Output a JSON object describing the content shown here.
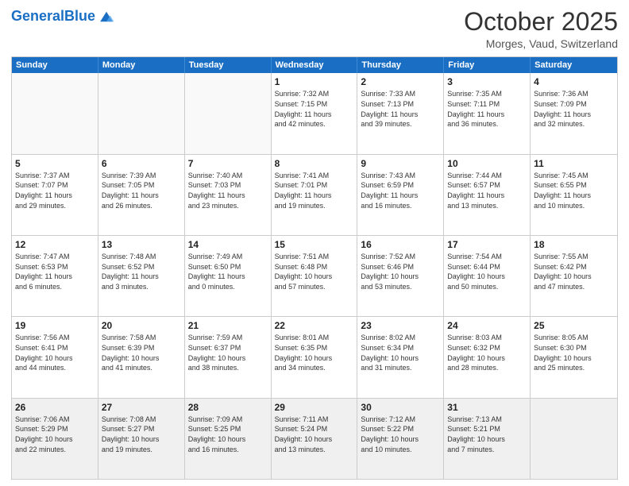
{
  "header": {
    "logo_general": "General",
    "logo_blue": "Blue",
    "month_title": "October 2025",
    "location": "Morges, Vaud, Switzerland"
  },
  "weekdays": [
    "Sunday",
    "Monday",
    "Tuesday",
    "Wednesday",
    "Thursday",
    "Friday",
    "Saturday"
  ],
  "rows": [
    [
      {
        "day": "",
        "text": "",
        "empty": true
      },
      {
        "day": "",
        "text": "",
        "empty": true
      },
      {
        "day": "",
        "text": "",
        "empty": true
      },
      {
        "day": "1",
        "text": "Sunrise: 7:32 AM\nSunset: 7:15 PM\nDaylight: 11 hours\nand 42 minutes."
      },
      {
        "day": "2",
        "text": "Sunrise: 7:33 AM\nSunset: 7:13 PM\nDaylight: 11 hours\nand 39 minutes."
      },
      {
        "day": "3",
        "text": "Sunrise: 7:35 AM\nSunset: 7:11 PM\nDaylight: 11 hours\nand 36 minutes."
      },
      {
        "day": "4",
        "text": "Sunrise: 7:36 AM\nSunset: 7:09 PM\nDaylight: 11 hours\nand 32 minutes."
      }
    ],
    [
      {
        "day": "5",
        "text": "Sunrise: 7:37 AM\nSunset: 7:07 PM\nDaylight: 11 hours\nand 29 minutes."
      },
      {
        "day": "6",
        "text": "Sunrise: 7:39 AM\nSunset: 7:05 PM\nDaylight: 11 hours\nand 26 minutes."
      },
      {
        "day": "7",
        "text": "Sunrise: 7:40 AM\nSunset: 7:03 PM\nDaylight: 11 hours\nand 23 minutes."
      },
      {
        "day": "8",
        "text": "Sunrise: 7:41 AM\nSunset: 7:01 PM\nDaylight: 11 hours\nand 19 minutes."
      },
      {
        "day": "9",
        "text": "Sunrise: 7:43 AM\nSunset: 6:59 PM\nDaylight: 11 hours\nand 16 minutes."
      },
      {
        "day": "10",
        "text": "Sunrise: 7:44 AM\nSunset: 6:57 PM\nDaylight: 11 hours\nand 13 minutes."
      },
      {
        "day": "11",
        "text": "Sunrise: 7:45 AM\nSunset: 6:55 PM\nDaylight: 11 hours\nand 10 minutes."
      }
    ],
    [
      {
        "day": "12",
        "text": "Sunrise: 7:47 AM\nSunset: 6:53 PM\nDaylight: 11 hours\nand 6 minutes."
      },
      {
        "day": "13",
        "text": "Sunrise: 7:48 AM\nSunset: 6:52 PM\nDaylight: 11 hours\nand 3 minutes."
      },
      {
        "day": "14",
        "text": "Sunrise: 7:49 AM\nSunset: 6:50 PM\nDaylight: 11 hours\nand 0 minutes."
      },
      {
        "day": "15",
        "text": "Sunrise: 7:51 AM\nSunset: 6:48 PM\nDaylight: 10 hours\nand 57 minutes."
      },
      {
        "day": "16",
        "text": "Sunrise: 7:52 AM\nSunset: 6:46 PM\nDaylight: 10 hours\nand 53 minutes."
      },
      {
        "day": "17",
        "text": "Sunrise: 7:54 AM\nSunset: 6:44 PM\nDaylight: 10 hours\nand 50 minutes."
      },
      {
        "day": "18",
        "text": "Sunrise: 7:55 AM\nSunset: 6:42 PM\nDaylight: 10 hours\nand 47 minutes."
      }
    ],
    [
      {
        "day": "19",
        "text": "Sunrise: 7:56 AM\nSunset: 6:41 PM\nDaylight: 10 hours\nand 44 minutes."
      },
      {
        "day": "20",
        "text": "Sunrise: 7:58 AM\nSunset: 6:39 PM\nDaylight: 10 hours\nand 41 minutes."
      },
      {
        "day": "21",
        "text": "Sunrise: 7:59 AM\nSunset: 6:37 PM\nDaylight: 10 hours\nand 38 minutes."
      },
      {
        "day": "22",
        "text": "Sunrise: 8:01 AM\nSunset: 6:35 PM\nDaylight: 10 hours\nand 34 minutes."
      },
      {
        "day": "23",
        "text": "Sunrise: 8:02 AM\nSunset: 6:34 PM\nDaylight: 10 hours\nand 31 minutes."
      },
      {
        "day": "24",
        "text": "Sunrise: 8:03 AM\nSunset: 6:32 PM\nDaylight: 10 hours\nand 28 minutes."
      },
      {
        "day": "25",
        "text": "Sunrise: 8:05 AM\nSunset: 6:30 PM\nDaylight: 10 hours\nand 25 minutes."
      }
    ],
    [
      {
        "day": "26",
        "text": "Sunrise: 7:06 AM\nSunset: 5:29 PM\nDaylight: 10 hours\nand 22 minutes."
      },
      {
        "day": "27",
        "text": "Sunrise: 7:08 AM\nSunset: 5:27 PM\nDaylight: 10 hours\nand 19 minutes."
      },
      {
        "day": "28",
        "text": "Sunrise: 7:09 AM\nSunset: 5:25 PM\nDaylight: 10 hours\nand 16 minutes."
      },
      {
        "day": "29",
        "text": "Sunrise: 7:11 AM\nSunset: 5:24 PM\nDaylight: 10 hours\nand 13 minutes."
      },
      {
        "day": "30",
        "text": "Sunrise: 7:12 AM\nSunset: 5:22 PM\nDaylight: 10 hours\nand 10 minutes."
      },
      {
        "day": "31",
        "text": "Sunrise: 7:13 AM\nSunset: 5:21 PM\nDaylight: 10 hours\nand 7 minutes."
      },
      {
        "day": "",
        "text": "",
        "empty": true
      }
    ]
  ]
}
